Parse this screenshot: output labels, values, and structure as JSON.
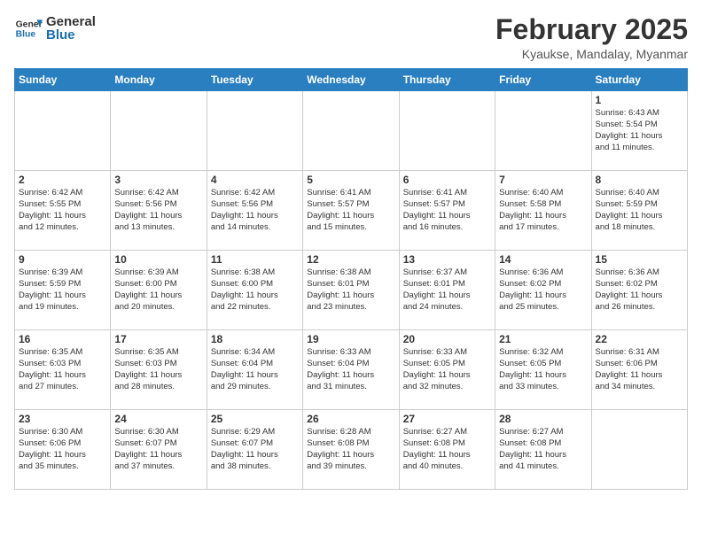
{
  "header": {
    "logo_general": "General",
    "logo_blue": "Blue",
    "title": "February 2025",
    "subtitle": "Kyaukse, Mandalay, Myanmar"
  },
  "calendar": {
    "days_of_week": [
      "Sunday",
      "Monday",
      "Tuesday",
      "Wednesday",
      "Thursday",
      "Friday",
      "Saturday"
    ],
    "weeks": [
      [
        {
          "day": "",
          "info": ""
        },
        {
          "day": "",
          "info": ""
        },
        {
          "day": "",
          "info": ""
        },
        {
          "day": "",
          "info": ""
        },
        {
          "day": "",
          "info": ""
        },
        {
          "day": "",
          "info": ""
        },
        {
          "day": "1",
          "info": "Sunrise: 6:43 AM\nSunset: 5:54 PM\nDaylight: 11 hours\nand 11 minutes."
        }
      ],
      [
        {
          "day": "2",
          "info": "Sunrise: 6:42 AM\nSunset: 5:55 PM\nDaylight: 11 hours\nand 12 minutes."
        },
        {
          "day": "3",
          "info": "Sunrise: 6:42 AM\nSunset: 5:56 PM\nDaylight: 11 hours\nand 13 minutes."
        },
        {
          "day": "4",
          "info": "Sunrise: 6:42 AM\nSunset: 5:56 PM\nDaylight: 11 hours\nand 14 minutes."
        },
        {
          "day": "5",
          "info": "Sunrise: 6:41 AM\nSunset: 5:57 PM\nDaylight: 11 hours\nand 15 minutes."
        },
        {
          "day": "6",
          "info": "Sunrise: 6:41 AM\nSunset: 5:57 PM\nDaylight: 11 hours\nand 16 minutes."
        },
        {
          "day": "7",
          "info": "Sunrise: 6:40 AM\nSunset: 5:58 PM\nDaylight: 11 hours\nand 17 minutes."
        },
        {
          "day": "8",
          "info": "Sunrise: 6:40 AM\nSunset: 5:59 PM\nDaylight: 11 hours\nand 18 minutes."
        }
      ],
      [
        {
          "day": "9",
          "info": "Sunrise: 6:39 AM\nSunset: 5:59 PM\nDaylight: 11 hours\nand 19 minutes."
        },
        {
          "day": "10",
          "info": "Sunrise: 6:39 AM\nSunset: 6:00 PM\nDaylight: 11 hours\nand 20 minutes."
        },
        {
          "day": "11",
          "info": "Sunrise: 6:38 AM\nSunset: 6:00 PM\nDaylight: 11 hours\nand 22 minutes."
        },
        {
          "day": "12",
          "info": "Sunrise: 6:38 AM\nSunset: 6:01 PM\nDaylight: 11 hours\nand 23 minutes."
        },
        {
          "day": "13",
          "info": "Sunrise: 6:37 AM\nSunset: 6:01 PM\nDaylight: 11 hours\nand 24 minutes."
        },
        {
          "day": "14",
          "info": "Sunrise: 6:36 AM\nSunset: 6:02 PM\nDaylight: 11 hours\nand 25 minutes."
        },
        {
          "day": "15",
          "info": "Sunrise: 6:36 AM\nSunset: 6:02 PM\nDaylight: 11 hours\nand 26 minutes."
        }
      ],
      [
        {
          "day": "16",
          "info": "Sunrise: 6:35 AM\nSunset: 6:03 PM\nDaylight: 11 hours\nand 27 minutes."
        },
        {
          "day": "17",
          "info": "Sunrise: 6:35 AM\nSunset: 6:03 PM\nDaylight: 11 hours\nand 28 minutes."
        },
        {
          "day": "18",
          "info": "Sunrise: 6:34 AM\nSunset: 6:04 PM\nDaylight: 11 hours\nand 29 minutes."
        },
        {
          "day": "19",
          "info": "Sunrise: 6:33 AM\nSunset: 6:04 PM\nDaylight: 11 hours\nand 31 minutes."
        },
        {
          "day": "20",
          "info": "Sunrise: 6:33 AM\nSunset: 6:05 PM\nDaylight: 11 hours\nand 32 minutes."
        },
        {
          "day": "21",
          "info": "Sunrise: 6:32 AM\nSunset: 6:05 PM\nDaylight: 11 hours\nand 33 minutes."
        },
        {
          "day": "22",
          "info": "Sunrise: 6:31 AM\nSunset: 6:06 PM\nDaylight: 11 hours\nand 34 minutes."
        }
      ],
      [
        {
          "day": "23",
          "info": "Sunrise: 6:30 AM\nSunset: 6:06 PM\nDaylight: 11 hours\nand 35 minutes."
        },
        {
          "day": "24",
          "info": "Sunrise: 6:30 AM\nSunset: 6:07 PM\nDaylight: 11 hours\nand 37 minutes."
        },
        {
          "day": "25",
          "info": "Sunrise: 6:29 AM\nSunset: 6:07 PM\nDaylight: 11 hours\nand 38 minutes."
        },
        {
          "day": "26",
          "info": "Sunrise: 6:28 AM\nSunset: 6:08 PM\nDaylight: 11 hours\nand 39 minutes."
        },
        {
          "day": "27",
          "info": "Sunrise: 6:27 AM\nSunset: 6:08 PM\nDaylight: 11 hours\nand 40 minutes."
        },
        {
          "day": "28",
          "info": "Sunrise: 6:27 AM\nSunset: 6:08 PM\nDaylight: 11 hours\nand 41 minutes."
        },
        {
          "day": "",
          "info": ""
        }
      ]
    ]
  }
}
